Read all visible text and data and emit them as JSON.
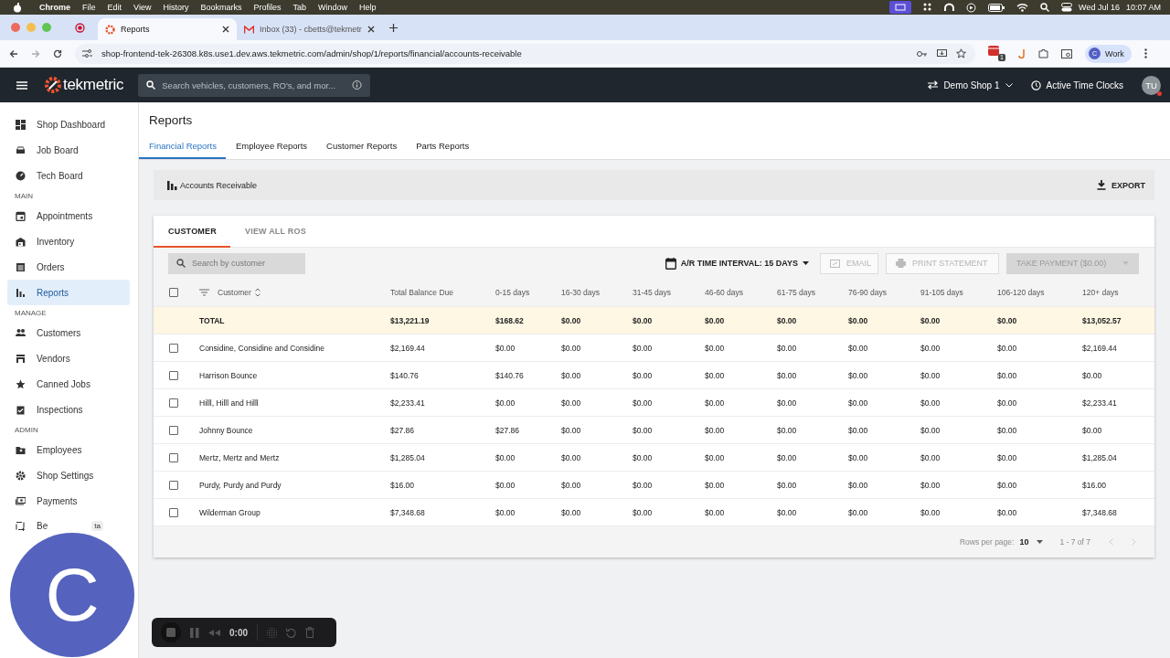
{
  "menu_bar": {
    "app": "Chrome",
    "menus": [
      "File",
      "Edit",
      "View",
      "History",
      "Bookmarks",
      "Profiles",
      "Tab",
      "Window",
      "Help"
    ],
    "date": "Wed Jul 16",
    "time": "10:07 AM"
  },
  "browser": {
    "tabs": [
      {
        "title": "Reports",
        "selected": true
      },
      {
        "title": "Inbox (33) - cbetts@tekmetr",
        "selected": false
      }
    ],
    "url": "shop-frontend-tek-26308.k8s.use1.dev.aws.tekmetric.com/admin/shop/1/reports/financial/accounts-receivable",
    "extension_badge": "1",
    "profile": {
      "initial": "C",
      "label": "Work"
    }
  },
  "app_header": {
    "logo": "tekmetric",
    "search": {
      "placeholder": "Search vehicles, customers, RO's, and mor..."
    },
    "shop": "Demo Shop 1",
    "time_clocks": "Active Time Clocks",
    "avatar": "TU"
  },
  "sidebar": {
    "groups": [
      {
        "items": [
          {
            "label": "Shop Dashboard",
            "selected": false
          },
          {
            "label": "Job Board",
            "selected": false
          },
          {
            "label": "Tech Board",
            "selected": false
          }
        ]
      },
      {
        "heading": "MAIN",
        "items": [
          {
            "label": "Appointments",
            "selected": false
          },
          {
            "label": "Inventory",
            "selected": false
          },
          {
            "label": "Orders",
            "selected": false
          },
          {
            "label": "Reports",
            "selected": true
          }
        ]
      },
      {
        "heading": "MANAGE",
        "items": [
          {
            "label": "Customers",
            "selected": false
          },
          {
            "label": "Vendors",
            "selected": false
          },
          {
            "label": "Canned Jobs",
            "selected": false
          },
          {
            "label": "Inspections",
            "selected": false
          }
        ]
      },
      {
        "heading": "ADMIN",
        "items": [
          {
            "label": "Employees",
            "selected": false
          },
          {
            "label": "Shop Settings",
            "selected": false
          },
          {
            "label": "Payments",
            "selected": false
          },
          {
            "label": "Be",
            "badge": "ta",
            "selected": false
          }
        ]
      }
    ]
  },
  "page": {
    "title": "Reports",
    "tabs": [
      {
        "label": "Financial Reports",
        "selected": true
      },
      {
        "label": "Employee Reports",
        "selected": false
      },
      {
        "label": "Customer Reports",
        "selected": false
      },
      {
        "label": "Parts Reports",
        "selected": false
      }
    ]
  },
  "report_bar": {
    "title": "Accounts Receivable",
    "export": "EXPORT"
  },
  "card": {
    "tabs": [
      {
        "label": "CUSTOMER",
        "selected": true
      },
      {
        "label": "VIEW ALL ROS",
        "selected": false
      }
    ],
    "search": {
      "placeholder": "Search by customer"
    },
    "interval": "A/R TIME INTERVAL: 15 DAYS",
    "buttons": [
      {
        "label": "EMAIL",
        "kind": "email",
        "disabled": true
      },
      {
        "label": "PRINT STATEMENT",
        "kind": "print",
        "disabled": true
      },
      {
        "label": "TAKE PAYMENT ($0.00)",
        "kind": "dropdown",
        "disabled": true
      }
    ],
    "table": {
      "select_all": {
        "checked": false
      },
      "columns": [
        "Customer",
        "Total Balance Due",
        "0-15 days",
        "16-30 days",
        "31-45 days",
        "46-60 days",
        "61-75 days",
        "76-90 days",
        "91-105 days",
        "106-120 days",
        "120+ days"
      ],
      "total": {
        "label": "TOTAL",
        "values": [
          "$13,221.19",
          "$168.62",
          "$0.00",
          "$0.00",
          "$0.00",
          "$0.00",
          "$0.00",
          "$0.00",
          "$0.00",
          "$13,052.57"
        ]
      },
      "rows": [
        {
          "checked": false,
          "customer": "Considine, Considine and Considine",
          "values": [
            "$2,169.44",
            "$0.00",
            "$0.00",
            "$0.00",
            "$0.00",
            "$0.00",
            "$0.00",
            "$0.00",
            "$0.00",
            "$2,169.44"
          ]
        },
        {
          "checked": false,
          "customer": "Harrison Bounce",
          "values": [
            "$140.76",
            "$140.76",
            "$0.00",
            "$0.00",
            "$0.00",
            "$0.00",
            "$0.00",
            "$0.00",
            "$0.00",
            "$0.00"
          ]
        },
        {
          "checked": false,
          "customer": "Hilll, Hilll and Hilll",
          "values": [
            "$2,233.41",
            "$0.00",
            "$0.00",
            "$0.00",
            "$0.00",
            "$0.00",
            "$0.00",
            "$0.00",
            "$0.00",
            "$2,233.41"
          ]
        },
        {
          "checked": false,
          "customer": "Johnny Bounce",
          "values": [
            "$27.86",
            "$27.86",
            "$0.00",
            "$0.00",
            "$0.00",
            "$0.00",
            "$0.00",
            "$0.00",
            "$0.00",
            "$0.00"
          ]
        },
        {
          "checked": false,
          "customer": "Mertz, Mertz and Mertz",
          "values": [
            "$1,285.04",
            "$0.00",
            "$0.00",
            "$0.00",
            "$0.00",
            "$0.00",
            "$0.00",
            "$0.00",
            "$0.00",
            "$1,285.04"
          ]
        },
        {
          "checked": false,
          "customer": "Purdy, Purdy and Purdy",
          "values": [
            "$16.00",
            "$0.00",
            "$0.00",
            "$0.00",
            "$0.00",
            "$0.00",
            "$0.00",
            "$0.00",
            "$0.00",
            "$16.00"
          ]
        },
        {
          "checked": false,
          "customer": "Wilderman Group",
          "values": [
            "$7,348.68",
            "$0.00",
            "$0.00",
            "$0.00",
            "$0.00",
            "$0.00",
            "$0.00",
            "$0.00",
            "$0.00",
            "$7,348.68"
          ]
        }
      ]
    },
    "pagination": {
      "rows_per_page_label": "Rows per page:",
      "rows_per_page": "10",
      "range": "1 - 7 of 7"
    }
  },
  "camera_bubble": {
    "initial": "C"
  },
  "recorder": {
    "time": "0:00"
  }
}
